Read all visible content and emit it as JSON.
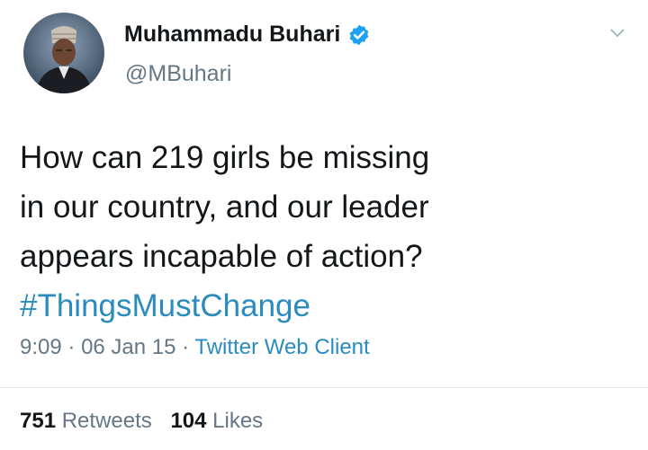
{
  "author": {
    "name": "Muhammadu Buhari",
    "handle": "@MBuhari",
    "verified_icon": "verified-badge-icon",
    "avatar_icon": "profile-photo"
  },
  "tweet": {
    "lines": [
      "How can 219 girls be missing",
      "in our country, and our leader",
      "appears incapable of action?"
    ],
    "hashtag": "#ThingsMustChange"
  },
  "meta": {
    "time": "9:09",
    "separator": "·",
    "date": "06 Jan 15",
    "source": "Twitter Web Client"
  },
  "stats": {
    "retweets_count": "751",
    "retweets_label": "Retweets",
    "likes_count": "104",
    "likes_label": "Likes"
  },
  "colors": {
    "link": "#2a8bbf",
    "verified": "#1da1f2",
    "muted": "#657786",
    "text": "#14171a"
  }
}
